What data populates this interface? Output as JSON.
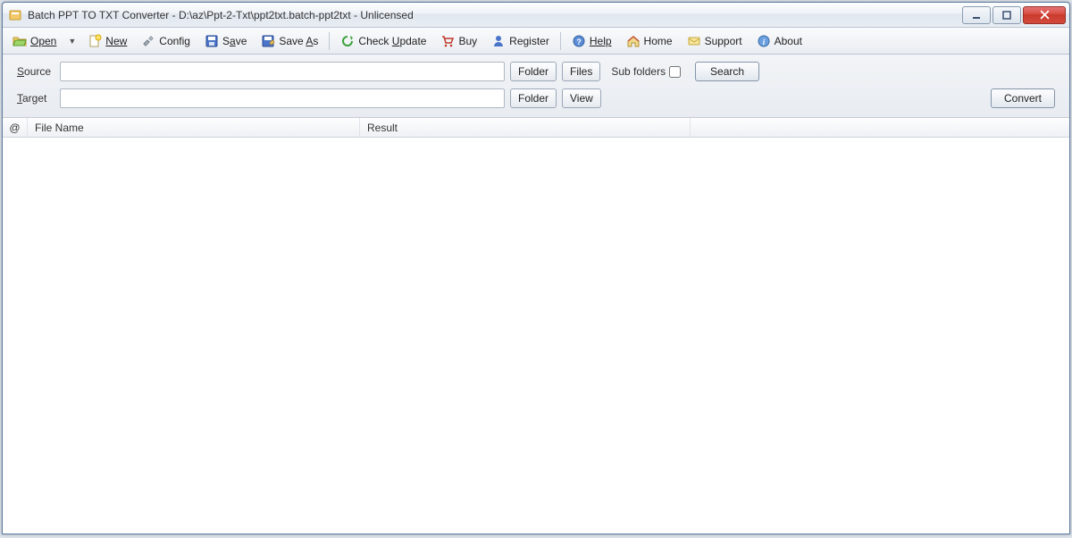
{
  "title": "Batch PPT TO TXT Converter - D:\\az\\Ppt-2-Txt\\ppt2txt.batch-ppt2txt - Unlicensed",
  "toolbar": {
    "open": "Open",
    "new": "New",
    "config": "Config",
    "save": "Save",
    "save_as": "Save As",
    "check_update": "Check Update",
    "buy": "Buy",
    "register": "Register",
    "help": "Help",
    "home": "Home",
    "support": "Support",
    "about": "About"
  },
  "form": {
    "source_label": "Source",
    "target_label": "Target",
    "folder_btn": "Folder",
    "files_btn": "Files",
    "view_btn": "View",
    "sub_folders_label": "Sub folders",
    "search_btn": "Search",
    "convert_btn": "Convert",
    "source_value": "",
    "target_value": ""
  },
  "table": {
    "col_at": "@",
    "col_file": "File Name",
    "col_result": "Result"
  }
}
